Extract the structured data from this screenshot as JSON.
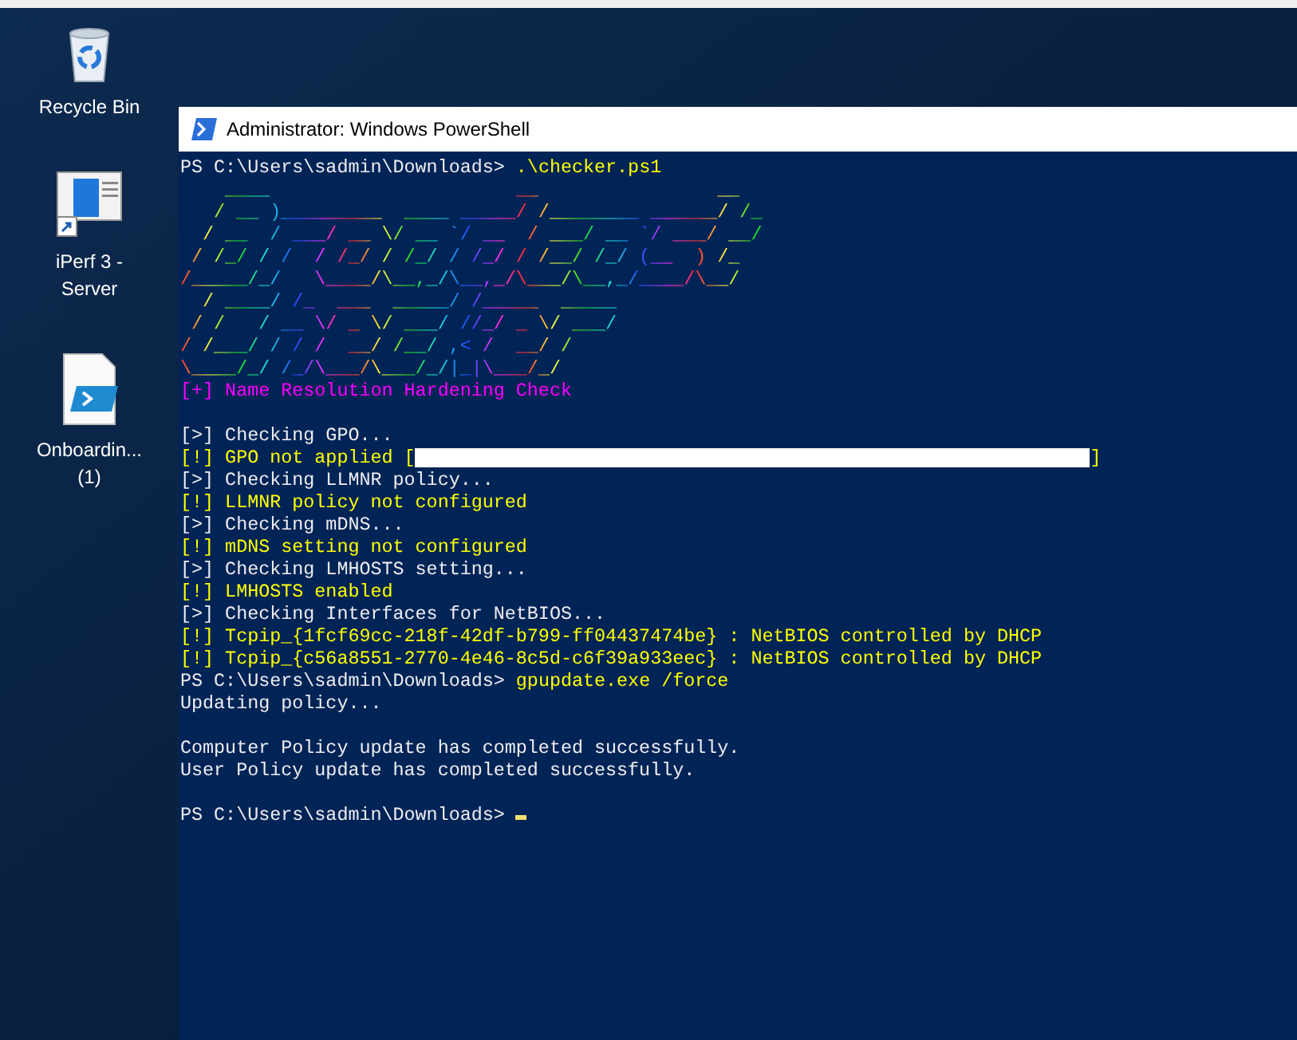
{
  "desktop": {
    "icons": [
      {
        "kind": "recycle-bin",
        "label_lines": [
          "Recycle Bin"
        ]
      },
      {
        "kind": "app-shortcut",
        "label_lines": [
          "iPerf 3 -",
          "Server"
        ]
      },
      {
        "kind": "script-file",
        "label_lines": [
          "Onboardin...",
          "(1)"
        ]
      }
    ]
  },
  "window": {
    "title": "Administrator: Windows PowerShell"
  },
  "console": {
    "lines": [
      [
        {
          "kind": "prompt",
          "text": "PS C:\\Users\\sadmin\\Downloads> "
        },
        {
          "kind": "command",
          "text": ".\\checker.ps1"
        }
      ],
      [
        {
          "kind": "banner",
          "text": "    ____                      __                __"
        }
      ],
      [
        {
          "kind": "banner",
          "text": "   / __ )_________  ____ _____/ /________ ______/ /_"
        }
      ],
      [
        {
          "kind": "banner",
          "text": "  / __  / ___/ __ \\/ __ `/ __  / ___/ __ `/ ___/ __/"
        }
      ],
      [
        {
          "kind": "banner",
          "text": " / /_/ / /  / /_/ / /_/ / /_/ / /__/ /_/ (__  ) /_"
        }
      ],
      [
        {
          "kind": "banner",
          "text": "/_____/_/   \\____/\\__,_/\\__,_/\\___/\\__,_/____/\\__/"
        }
      ],
      [
        {
          "kind": "banner",
          "text": "  / ____/ /_  ___  _____/ /_____  _____"
        }
      ],
      [
        {
          "kind": "banner",
          "text": " / /   / __ \\/ _ \\/ ___/ //_/ _ \\/ ___/"
        }
      ],
      [
        {
          "kind": "banner",
          "text": "/ /___/ / / /  __/ /__/ ,< /  __/ /"
        }
      ],
      [
        {
          "kind": "banner",
          "text": "\\____/_/ /_/\\___/\\___/_/|_|\\___/_/"
        }
      ],
      [
        {
          "kind": "heading",
          "text": "[+] Name Resolution Hardening Check"
        }
      ],
      [
        {
          "kind": "info",
          "gap_before": true,
          "text": "[>] Checking GPO..."
        }
      ],
      [
        {
          "kind": "warn",
          "text": "[!] GPO not applied ["
        },
        {
          "kind": "redaction"
        },
        {
          "kind": "warn",
          "text": "]"
        }
      ],
      [
        {
          "kind": "info",
          "text": "[>] Checking LLMNR policy..."
        }
      ],
      [
        {
          "kind": "warn",
          "text": "[!] LLMNR policy not configured"
        }
      ],
      [
        {
          "kind": "info",
          "text": "[>] Checking mDNS..."
        }
      ],
      [
        {
          "kind": "warn",
          "text": "[!] mDNS setting not configured"
        }
      ],
      [
        {
          "kind": "info",
          "text": "[>] Checking LMHOSTS setting..."
        }
      ],
      [
        {
          "kind": "warn",
          "text": "[!] LMHOSTS enabled"
        }
      ],
      [
        {
          "kind": "info",
          "text": "[>] Checking Interfaces for NetBIOS..."
        }
      ],
      [
        {
          "kind": "warn",
          "text": "[!] Tcpip_{1fcf69cc-218f-42df-b799-ff04437474be} : NetBIOS controlled by DHCP"
        }
      ],
      [
        {
          "kind": "warn",
          "text": "[!] Tcpip_{c56a8551-2770-4e46-8c5d-c6f39a933eec} : NetBIOS controlled by DHCP"
        }
      ],
      [
        {
          "kind": "prompt",
          "text": "PS C:\\Users\\sadmin\\Downloads> "
        },
        {
          "kind": "command",
          "text": "gpupdate.exe /force"
        }
      ],
      [
        {
          "kind": "output",
          "text": "Updating policy..."
        }
      ],
      [
        {
          "kind": "output",
          "gap_before": true,
          "text": "Computer Policy update has completed successfully."
        }
      ],
      [
        {
          "kind": "output",
          "text": "User Policy update has completed successfully."
        }
      ],
      [
        {
          "kind": "prompt",
          "gap_before": true,
          "text": "PS C:\\Users\\sadmin\\Downloads> "
        },
        {
          "kind": "cursor"
        }
      ]
    ]
  }
}
